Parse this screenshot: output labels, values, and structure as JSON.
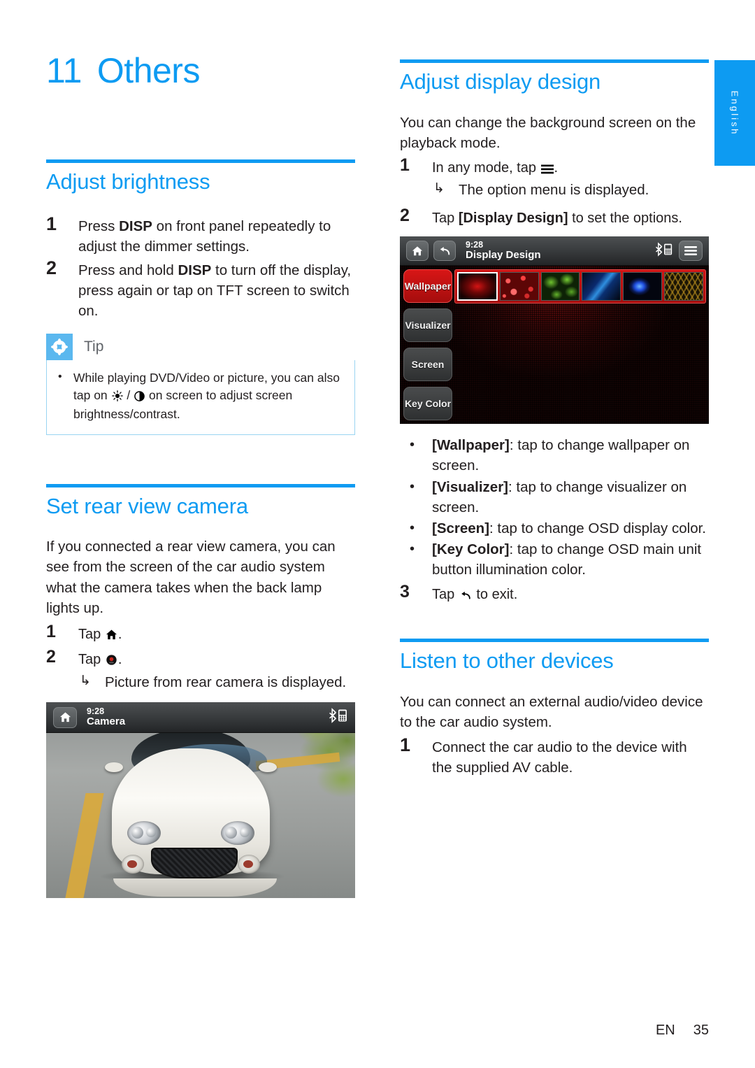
{
  "chapter": {
    "number": "11",
    "title": "Others"
  },
  "colors": {
    "accent": "#0d9bf2",
    "tip_icon_bg": "#5bb8ef",
    "tip_border": "#9ad4f2",
    "device_active": "#cf1414"
  },
  "sections": {
    "adjust_brightness": {
      "title": "Adjust brightness",
      "steps": [
        {
          "num": "1",
          "text_before": "Press ",
          "bold": "DISP",
          "text_after": " on front panel repeatedly to adjust the dimmer settings."
        },
        {
          "num": "2",
          "text_before": "Press and hold ",
          "bold": "DISP",
          "text_after": " to turn off the display, press again or tap on TFT screen to switch on."
        }
      ],
      "tip": {
        "label": "Tip",
        "icon": "asterisk-icon",
        "bullet": "•",
        "text_a": "While playing DVD/Video or picture, you can also tap on ",
        "icon_brightness": "brightness-icon",
        "separator": " / ",
        "icon_contrast": "contrast-icon",
        "text_b": " on screen to adjust screen brightness/contrast."
      }
    },
    "set_rear_view_camera": {
      "title": "Set rear view camera",
      "intro": "If you connected a rear view camera, you can see from the screen of the car audio system what the camera takes when the back lamp lights up.",
      "steps": [
        {
          "num": "1",
          "text": "Tap ",
          "icon": "home-icon",
          "suffix": "."
        },
        {
          "num": "2",
          "text": "Tap ",
          "icon": "camera-icon",
          "suffix": "."
        }
      ],
      "substep": {
        "arrow": "↳",
        "text": "Picture from rear camera is displayed."
      },
      "screenshot": {
        "name": "camera-screen",
        "clock": "9:28",
        "title": "Camera",
        "left_buttons": [
          {
            "name": "home-icon",
            "glyph": "home"
          }
        ],
        "right_icons": [
          {
            "name": "bluetooth-phone-icon"
          }
        ]
      }
    },
    "adjust_display_design": {
      "title": "Adjust display design",
      "intro": "You can change the background screen on the playback mode.",
      "steps": [
        {
          "num": "1",
          "text": "In any mode, tap ",
          "icon": "menu-icon",
          "suffix": "."
        },
        {
          "num": "2",
          "text_before": "Tap ",
          "bold": "[Display Design]",
          "text_after": " to set the options."
        },
        {
          "num": "3",
          "text": "Tap ",
          "icon": "back-icon",
          "suffix": " to exit."
        }
      ],
      "substep": {
        "arrow": "↳",
        "text": "The option menu is displayed."
      },
      "screenshot": {
        "name": "display-design-screen",
        "clock": "9:28",
        "title": "Display Design",
        "left_buttons": [
          {
            "name": "home-icon"
          },
          {
            "name": "back-icon"
          }
        ],
        "right_icons": [
          {
            "name": "bluetooth-phone-icon"
          },
          {
            "name": "menu-icon"
          }
        ],
        "side_menu": [
          {
            "label": "Wallpaper",
            "active": true
          },
          {
            "label": "Visualizer",
            "active": false
          },
          {
            "label": "Screen",
            "active": false
          },
          {
            "label": "Key Color",
            "active": false
          }
        ],
        "thumbnails": [
          {
            "name": "wallpaper-red-radial",
            "selected": true
          },
          {
            "name": "wallpaper-red-bokeh",
            "selected": false
          },
          {
            "name": "wallpaper-green-cells",
            "selected": false
          },
          {
            "name": "wallpaper-blue-swoosh",
            "selected": false
          },
          {
            "name": "wallpaper-blue-burst",
            "selected": false
          },
          {
            "name": "wallpaper-gold-hex",
            "selected": false
          }
        ]
      },
      "options": [
        {
          "bullet": "•",
          "term": "[Wallpaper]",
          "desc": ": tap to change wallpaper on screen."
        },
        {
          "bullet": "•",
          "term": "[Visualizer]",
          "desc": ": tap to change visualizer on screen."
        },
        {
          "bullet": "•",
          "term": "[Screen]",
          "desc": ": tap to change OSD display color."
        },
        {
          "bullet": "•",
          "term": "[Key Color]",
          "desc": ": tap to change OSD main unit button illumination color."
        }
      ]
    },
    "listen_to_other_devices": {
      "title": "Listen to other devices",
      "intro": "You can connect an external audio/video device to the car audio system.",
      "steps": [
        {
          "num": "1",
          "text": "Connect the car audio to the device with the supplied AV cable."
        }
      ]
    }
  },
  "side_tab": {
    "label": "English"
  },
  "footer": {
    "lang": "EN",
    "page": "35"
  }
}
